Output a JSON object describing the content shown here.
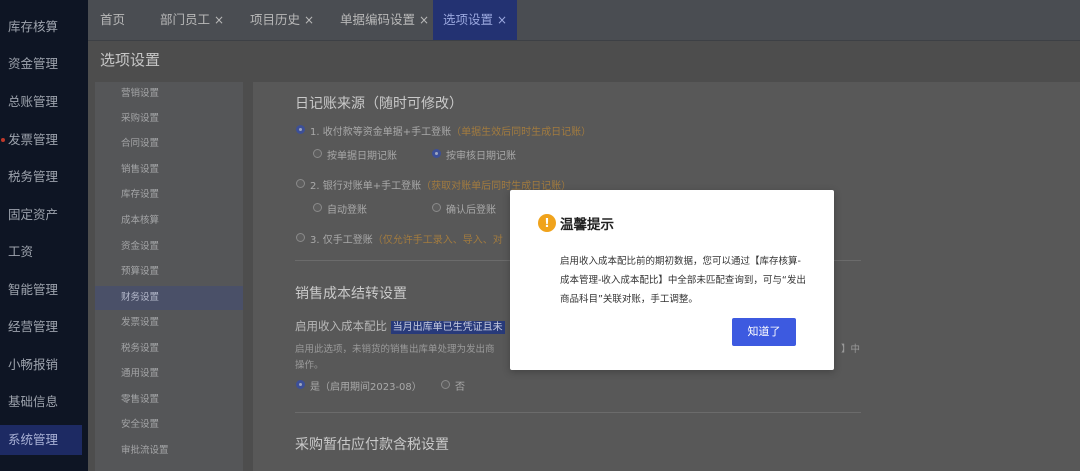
{
  "nav": {
    "items": [
      {
        "label": "库存核算"
      },
      {
        "label": "资金管理"
      },
      {
        "label": "总账管理"
      },
      {
        "label": "发票管理"
      },
      {
        "label": "税务管理"
      },
      {
        "label": "固定资产"
      },
      {
        "label": "工资"
      },
      {
        "label": "智能管理"
      },
      {
        "label": "经营管理"
      },
      {
        "label": "小畅报销"
      },
      {
        "label": "基础信息"
      },
      {
        "label": "系统管理"
      }
    ]
  },
  "tabs": [
    {
      "label": "首页"
    },
    {
      "label": "部门员工",
      "close": "×"
    },
    {
      "label": "项目历史",
      "close": "×"
    },
    {
      "label": "单据编码设置",
      "close": "×"
    },
    {
      "label": "选项设置",
      "close": "×"
    }
  ],
  "page_title": "选项设置",
  "submenu": [
    "营销设置",
    "采购设置",
    "合同设置",
    "销售设置",
    "库存设置",
    "成本核算",
    "资金设置",
    "预算设置",
    "财务设置",
    "发票设置",
    "税务设置",
    "通用设置",
    "零售设置",
    "安全设置",
    "审批流设置"
  ],
  "content": {
    "section1_title": "日记账来源（随时可修改）",
    "opt1_label": "1. 收付款等资金单据+手工登账",
    "opt1_note": "（单据生效后同时生成日记账）",
    "opt1_sub_a": "按单据日期记账",
    "opt1_sub_b": "按审核日期记账",
    "opt2_label": "2. 银行对账单+手工登账",
    "opt2_note": "（获取对账单后同时生成日记账）",
    "opt2_sub_a": "自动登账",
    "opt2_sub_b": "确认后登账",
    "opt3_label": "3. 仅手工登账",
    "opt3_note": "（仅允许手工录入、导入、对",
    "section2_title": "销售成本结转设置",
    "cost_label": "启用收入成本配比",
    "cost_highlight": "当月出库单已生凭证且未",
    "cost_desc_1": "启用此选项，未销货的销售出库单处理为发出商",
    "cost_desc_1b": "】中",
    "cost_desc_2": "操作。",
    "yes_label": "是（启用期间2023-08）",
    "no_label": "否",
    "section3_title": "采购暂估应付款含税设置"
  },
  "modal": {
    "icon": "!",
    "title": "温馨提示",
    "body": "启用收入成本配比前的期初数据，您可以通过【库存核算-成本管理-收入成本配比】中全部未匹配查询到，可与“发出商品科目”关联对账，手工调整。",
    "ok_label": "知道了"
  }
}
